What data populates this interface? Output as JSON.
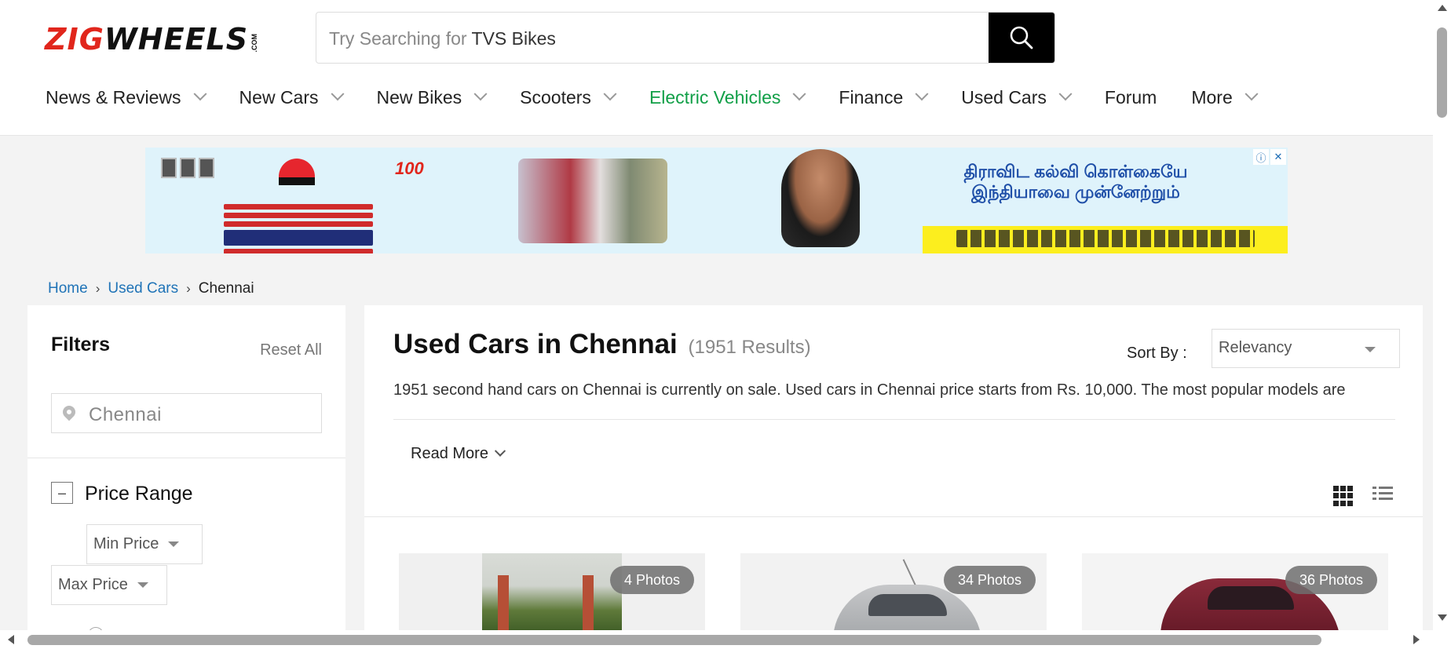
{
  "header": {
    "logo_brand": "ZIGWHEELS",
    "logo_part1": "ZIG",
    "logo_part2": "WHEELS",
    "logo_suffix": ".COM",
    "search": {
      "placeholder": "Try Searching for",
      "hint": "TVS Bikes",
      "icon": "search-icon"
    },
    "nav": [
      {
        "label": "News & Reviews",
        "dropdown": true
      },
      {
        "label": "New Cars",
        "dropdown": true
      },
      {
        "label": "New Bikes",
        "dropdown": true
      },
      {
        "label": "Scooters",
        "dropdown": true
      },
      {
        "label": "Electric Vehicles",
        "dropdown": true,
        "color": "#109f47"
      },
      {
        "label": "Finance",
        "dropdown": true
      },
      {
        "label": "Used Cars",
        "dropdown": true
      },
      {
        "label": "Forum",
        "dropdown": false
      },
      {
        "label": "More",
        "dropdown": true
      }
    ]
  },
  "ad": {
    "badge": "100",
    "headline_line1": "திராவிட கல்வி கொள்கையே",
    "headline_line2": "இந்தியாவை முன்னேற்றும்",
    "info_icon": "ⓘ",
    "close_icon": "✕"
  },
  "breadcrumb": {
    "items": [
      "Home",
      "Used Cars"
    ],
    "current": "Chennai",
    "separator": "›"
  },
  "filters": {
    "title": "Filters",
    "reset_label": "Reset All",
    "location_value": "Chennai",
    "price_range": {
      "label": "Price Range",
      "toggle": "–",
      "min_label": "Min Price",
      "max_label": "Max Price"
    }
  },
  "results": {
    "title": "Used Cars in Chennai",
    "count_text": "(1951 Results)",
    "sort_label": "Sort By :",
    "sort_value": "Relevancy",
    "description": "1951 second hand cars on Chennai is currently on sale. Used cars in Chennai price starts from Rs. 10,000. The most popular models are",
    "read_more": "Read More",
    "view_modes": [
      "grid-view-icon",
      "list-view-icon"
    ],
    "cards": [
      {
        "photos": "4 Photos"
      },
      {
        "photos": "34 Photos"
      },
      {
        "photos": "36 Photos"
      }
    ]
  },
  "colors": {
    "brand_red": "#e1261c",
    "link_blue": "#1f73b7",
    "ev_green": "#109f47"
  }
}
